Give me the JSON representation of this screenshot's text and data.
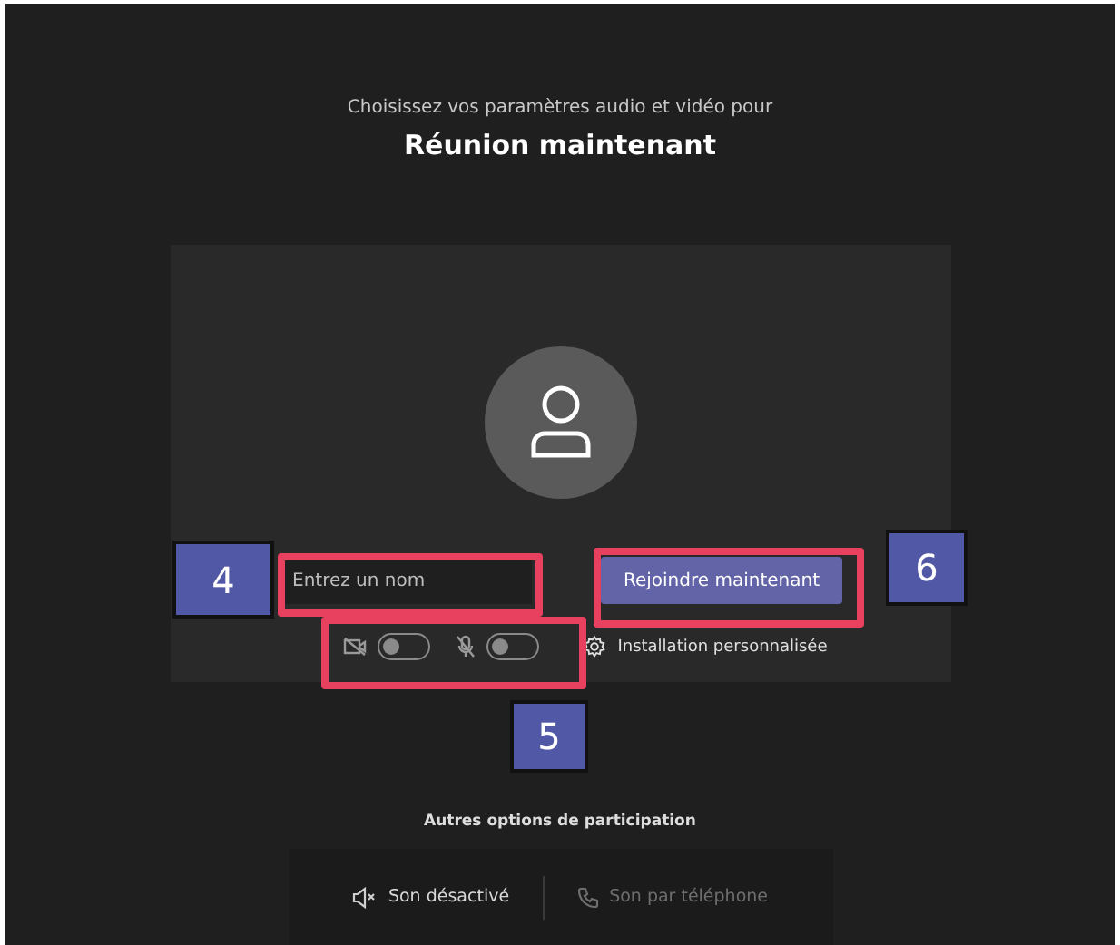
{
  "header": {
    "subtitle": "Choisissez vos paramètres audio et vidéo pour",
    "title": "Réunion maintenant"
  },
  "prejoin": {
    "name_field": {
      "placeholder": "Entrez un nom"
    },
    "join_button": "Rejoindre maintenant",
    "toggles": [
      {
        "kind": "camera",
        "on": false
      },
      {
        "kind": "microphone",
        "on": false
      }
    ],
    "settings_link": "Installation personnalisée"
  },
  "other_options": {
    "heading": "Autres options de participation",
    "options": [
      {
        "kind": "sound-off",
        "label": "Son désactivé",
        "disabled": false
      },
      {
        "kind": "phone",
        "label": "Son par téléphone",
        "disabled": true
      }
    ]
  },
  "callouts": [
    {
      "label": "4"
    },
    {
      "label": "5"
    },
    {
      "label": "6"
    }
  ]
}
